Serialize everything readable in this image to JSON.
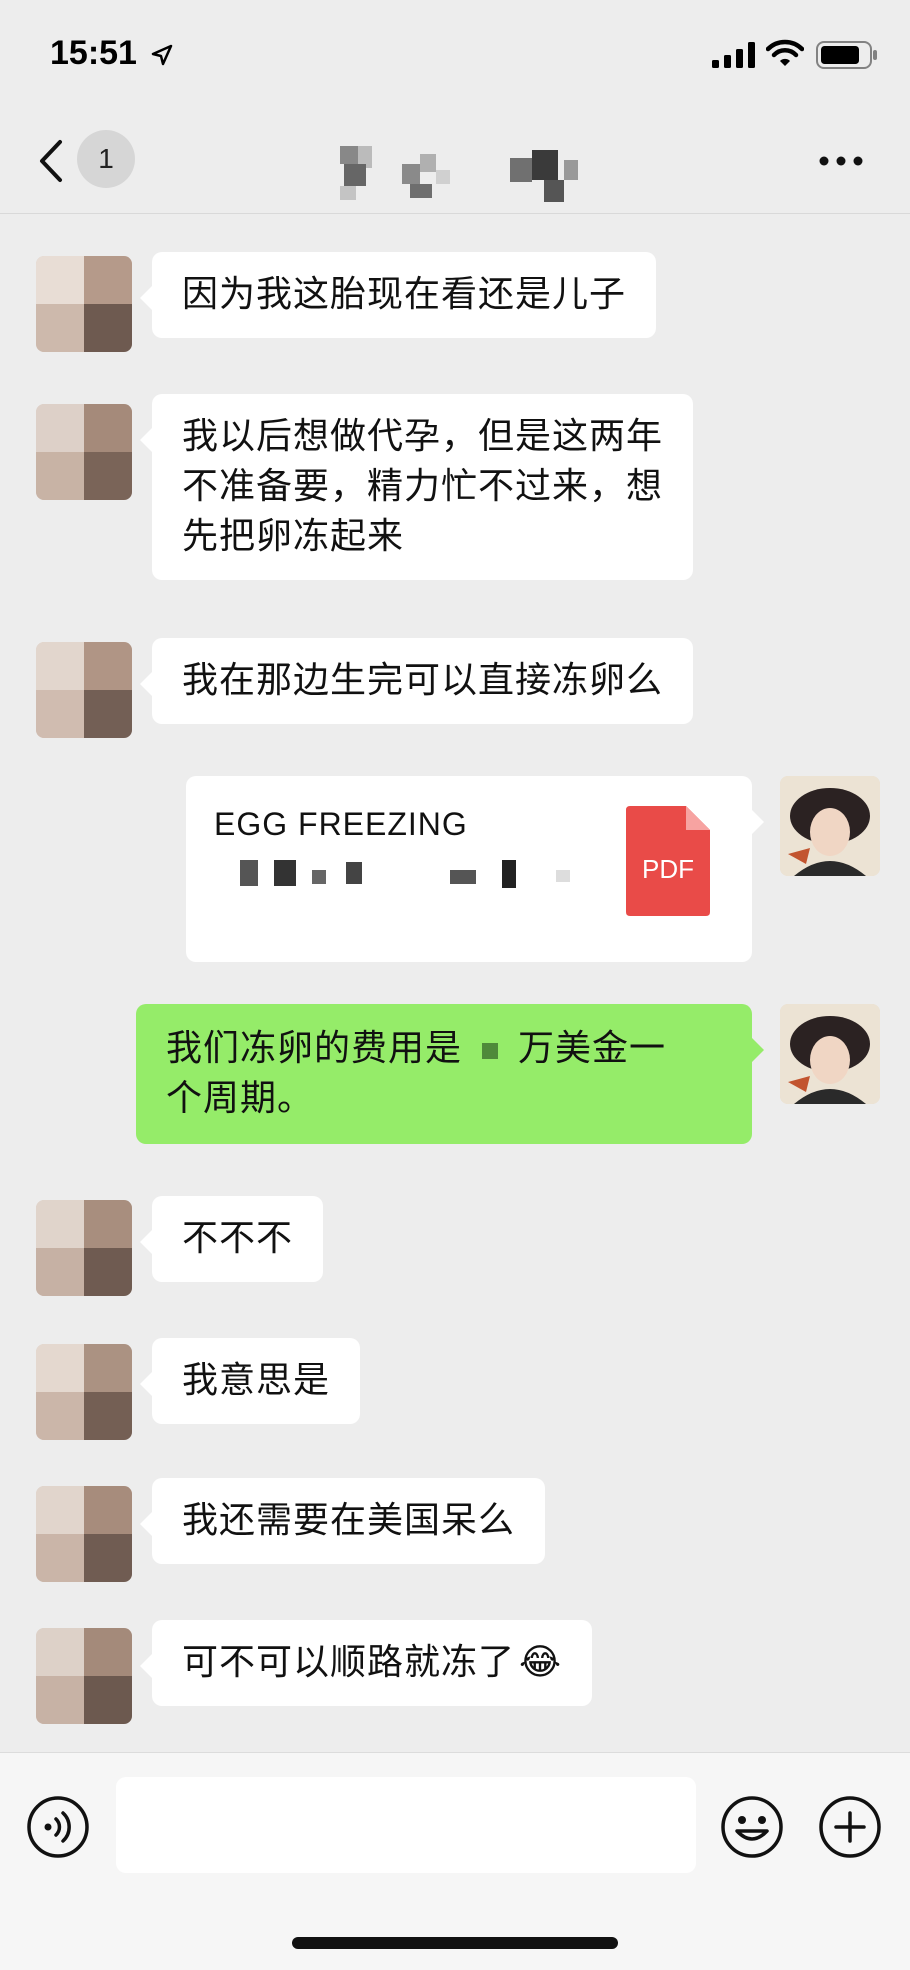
{
  "status_bar": {
    "time": "15:51",
    "icons": [
      "location-arrow-icon",
      "cellular-signal-icon",
      "wifi-icon",
      "battery-icon"
    ]
  },
  "nav_bar": {
    "back_icon": "chevron-left-icon",
    "unread_count": "1",
    "title": "",
    "more_icon": "more-dots-icon"
  },
  "messages": [
    {
      "side": "left",
      "text": "因为我这胎现在看还是儿子"
    },
    {
      "side": "left",
      "lines": [
        "我以后想做代孕，但是这两年",
        "不准备要，精力忙不过来，想",
        "先把卵冻起来"
      ]
    },
    {
      "side": "left",
      "text": "我在那边生完可以直接冻卵么"
    },
    {
      "side": "right",
      "type": "file",
      "file_name": "EGG FREEZING",
      "file_badge": "PDF"
    },
    {
      "side": "right",
      "line1_before": "我们冻卵的费用是",
      "line1_after": "万美金一",
      "line2": "个周期。"
    },
    {
      "side": "left",
      "text": "不不不"
    },
    {
      "side": "left",
      "text": "我意思是"
    },
    {
      "side": "left",
      "text": "我还需要在美国呆么"
    },
    {
      "side": "left",
      "text": "可不可以顺路就冻了",
      "emoji": "😂"
    }
  ],
  "input_bar": {
    "voice_icon": "voice-icon",
    "input_value": "",
    "emoji_icon": "emoji-icon",
    "plus_icon": "plus-icon"
  },
  "colors": {
    "background": "#ededed",
    "outgoing_bubble": "#95ec69",
    "incoming_bubble": "#ffffff",
    "pdf_red": "#e94b48"
  }
}
